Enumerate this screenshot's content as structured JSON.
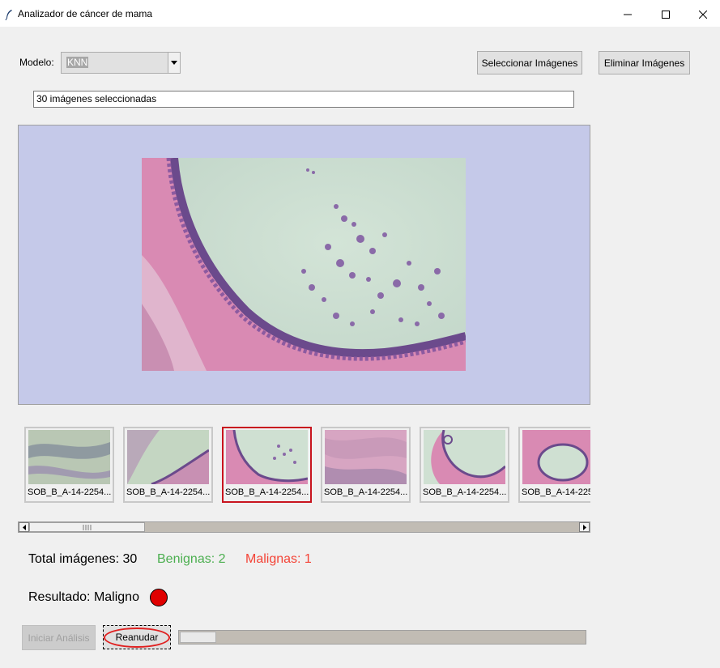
{
  "window": {
    "title": "Analizador de cáncer de mama"
  },
  "model": {
    "label": "Modelo:",
    "selected": "KNN"
  },
  "buttons": {
    "select_images": "Seleccionar Imágenes",
    "delete_images": "Eliminar Imágenes",
    "start_analysis": "Iniciar Análisis",
    "resume": "Reanudar"
  },
  "status_entry": {
    "value": "30 imágenes seleccionadas"
  },
  "thumbnails": [
    {
      "caption": "SOB_B_A-14-2254..."
    },
    {
      "caption": "SOB_B_A-14-2254..."
    },
    {
      "caption": "SOB_B_A-14-2254..."
    },
    {
      "caption": "SOB_B_A-14-2254..."
    },
    {
      "caption": "SOB_B_A-14-2254..."
    },
    {
      "caption": "SOB_B_A-14-225"
    }
  ],
  "stats": {
    "total": "Total imágenes: 30",
    "benign": "Benignas: 2",
    "malignant": "Malignas: 1",
    "benign_color": "#4caf50",
    "malignant_color": "#f44336"
  },
  "result": {
    "text": "Resultado: Maligno",
    "indicator_color": "#e00000"
  },
  "progress": {
    "fraction": 0.09
  },
  "icons": {
    "app": "feather-icon",
    "minimize": "minimize-icon",
    "maximize": "maximize-icon",
    "close": "close-icon",
    "dropdown": "chevron-down-icon",
    "scroll_left": "arrow-left-icon",
    "scroll_right": "arrow-right-icon"
  }
}
